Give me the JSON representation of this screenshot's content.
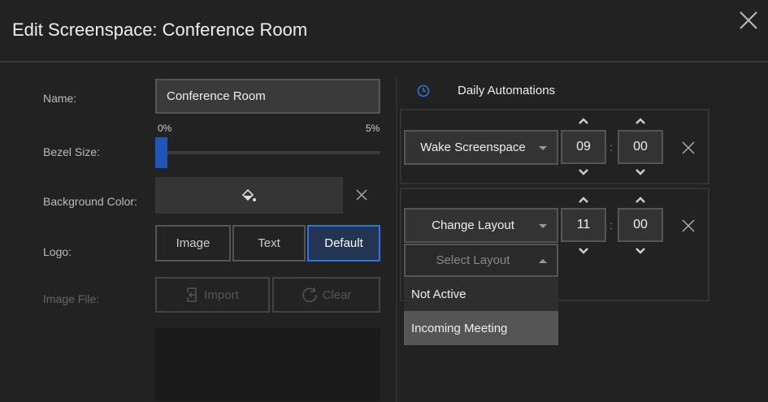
{
  "dialog": {
    "title": "Edit Screenspace: Conference  Room"
  },
  "form": {
    "name_label": "Name:",
    "name_value": "Conference Room",
    "bezel_label": "Bezel Size:",
    "bezel_min": "0%",
    "bezel_max": "5%",
    "bezel_value_fraction": 0,
    "bg_label": "Background Color:",
    "logo_label": "Logo:",
    "logo_options": [
      "Image",
      "Text",
      "Default"
    ],
    "logo_selected": "Default",
    "image_file_label": "Image File:",
    "import_label": "Import",
    "clear_label": "Clear"
  },
  "automations": {
    "title": "Daily Automations",
    "items": [
      {
        "action": "Wake Screenspace",
        "hour": "09",
        "minute": "00"
      },
      {
        "action": "Change Layout",
        "hour": "11",
        "minute": "00",
        "layout_placeholder": "Select Layout",
        "layout_options": [
          "Not Active",
          "Incoming Meeting"
        ]
      }
    ],
    "colon": ":"
  },
  "colors": {
    "accent": "#2f74e0",
    "selected_bg": "#233552"
  }
}
